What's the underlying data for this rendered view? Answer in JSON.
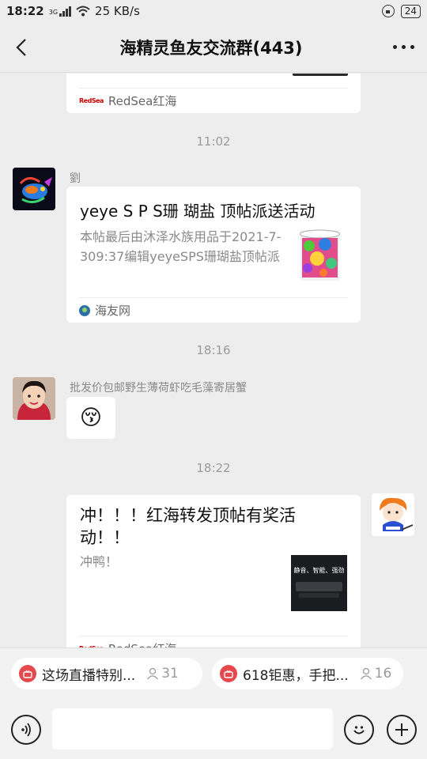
{
  "status": {
    "time": "18:22",
    "network": "3G",
    "speed": "25 KB/s",
    "battery": "24"
  },
  "header": {
    "title": "海精灵鱼友交流群(443)"
  },
  "messages": {
    "card_top": {
      "source": "RedSea红海"
    },
    "time1": "11:02",
    "msg1": {
      "nick": "劉",
      "title": "yeye S P S珊 瑚盐 顶帖派送活动",
      "desc": "本帖最后由沐泽水族用品于2021-7-309:37编辑yeyeSPS珊瑚盐顶帖派送活动一、活动...",
      "source": "海友网"
    },
    "time2": "18:16",
    "msg2": {
      "nick": "批发价包邮野生薄荷虾吃毛藻寄居蟹",
      "emoji": "😚"
    },
    "time3": "18:22",
    "msg3": {
      "title": "冲！！！红海转发顶帖有奖活动！！",
      "desc": "冲鸭！",
      "source": "RedSea红海",
      "thumb_text": "静音、智能、强劲"
    }
  },
  "shortcuts": [
    {
      "label": "这场直播特别...",
      "count": "31"
    },
    {
      "label": "618钜惠，手把...",
      "count": "16"
    }
  ]
}
